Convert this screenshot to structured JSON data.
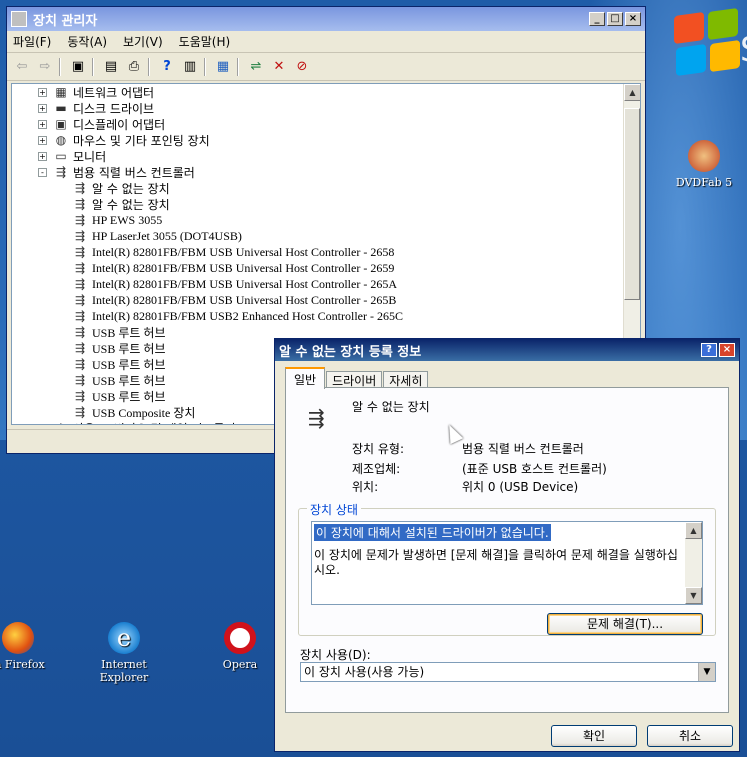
{
  "desktop": {
    "icons": [
      {
        "label": "DVDFab 5",
        "icon": "dvdfab-icon"
      },
      {
        "label": "la Firefox",
        "icon": "firefox-icon"
      },
      {
        "label": "Internet Explorer",
        "icon": "ie-icon"
      },
      {
        "label": "Opera",
        "icon": "opera-icon"
      }
    ],
    "logo_fragment": "S"
  },
  "device_manager": {
    "title": "장치 관리자",
    "menu": [
      "파일(F)",
      "동작(A)",
      "보기(V)",
      "도움말(H)"
    ],
    "tree": [
      {
        "label": "네트워크 어댑터",
        "level": 0,
        "expander": "+",
        "icon": "network-icon"
      },
      {
        "label": "디스크 드라이브",
        "level": 0,
        "expander": "+",
        "icon": "disk-icon"
      },
      {
        "label": "디스플레이 어댑터",
        "level": 0,
        "expander": "+",
        "icon": "display-icon"
      },
      {
        "label": "마우스 및 기타 포인팅 장치",
        "level": 0,
        "expander": "+",
        "icon": "mouse-icon"
      },
      {
        "label": "모니터",
        "level": 0,
        "expander": "+",
        "icon": "monitor-icon"
      },
      {
        "label": "범용 직렬 버스 컨트롤러",
        "level": 0,
        "expander": "-",
        "icon": "usb-icon"
      },
      {
        "label": "알 수 없는 장치",
        "level": 1,
        "icon": "usb-icon"
      },
      {
        "label": "알 수 없는 장치",
        "level": 1,
        "icon": "usb-icon"
      },
      {
        "label": "HP EWS 3055",
        "level": 1,
        "icon": "usb-icon"
      },
      {
        "label": "HP LaserJet 3055 (DOT4USB)",
        "level": 1,
        "icon": "usb-icon"
      },
      {
        "label": "Intel(R) 82801FB/FBM USB Universal Host Controller - 2658",
        "level": 1,
        "icon": "usb-icon"
      },
      {
        "label": "Intel(R) 82801FB/FBM USB Universal Host Controller - 2659",
        "level": 1,
        "icon": "usb-icon"
      },
      {
        "label": "Intel(R) 82801FB/FBM USB Universal Host Controller - 265A",
        "level": 1,
        "icon": "usb-icon"
      },
      {
        "label": "Intel(R) 82801FB/FBM USB Universal Host Controller - 265B",
        "level": 1,
        "icon": "usb-icon"
      },
      {
        "label": "Intel(R) 82801FB/FBM USB2 Enhanced Host Controller - 265C",
        "level": 1,
        "icon": "usb-icon"
      },
      {
        "label": "USB 루트 허브",
        "level": 1,
        "icon": "usb-icon"
      },
      {
        "label": "USB 루트 허브",
        "level": 1,
        "icon": "usb-icon"
      },
      {
        "label": "USB 루트 허브",
        "level": 1,
        "icon": "usb-icon"
      },
      {
        "label": "USB 루트 허브",
        "level": 1,
        "icon": "usb-icon"
      },
      {
        "label": "USB 루트 허브",
        "level": 1,
        "icon": "usb-icon"
      },
      {
        "label": "USB Composite 장치",
        "level": 1,
        "icon": "usb-icon"
      },
      {
        "label": "사운드, 비디오 및 게임 컨트롤러",
        "level": 0,
        "expander": "+",
        "icon": "sound-icon"
      }
    ]
  },
  "dialog": {
    "title": "알 수 없는 장치 등록 정보",
    "tabs": [
      "일반",
      "드라이버",
      "자세히"
    ],
    "device_name": "알 수 없는 장치",
    "props": [
      {
        "label": "장치 유형:",
        "value": "범용 직렬 버스 컨트롤러"
      },
      {
        "label": "제조업체:",
        "value": "(표준 USB 호스트 컨트롤러)"
      },
      {
        "label": "위치:",
        "value": "위치 0 (USB Device)"
      }
    ],
    "status_group_label": "장치 상태",
    "status_line1": "이 장치에 대해서 설치된 드라이버가 없습니다.",
    "status_line2": "이 장치에 문제가 발생하면 [문제 해결]을 클릭하여 문제 해결을 실행하십시오.",
    "troubleshoot_button": "문제 해결(T)...",
    "usage_label": "장치 사용(D):",
    "usage_value": "이 장치 사용(사용 가능)",
    "ok_button": "확인",
    "cancel_button": "취소"
  }
}
